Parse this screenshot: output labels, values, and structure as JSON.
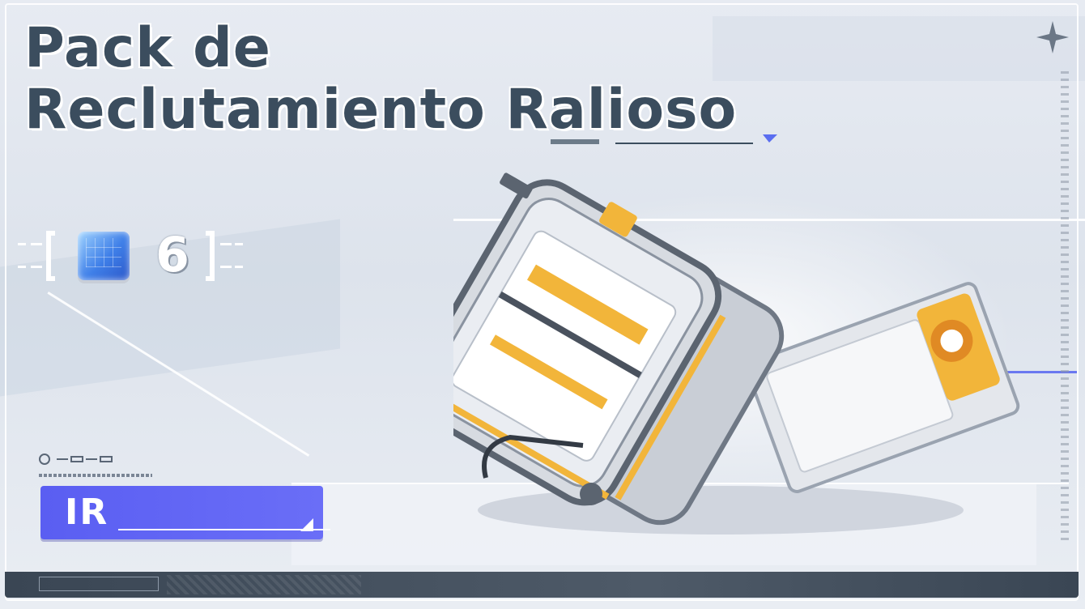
{
  "title": {
    "line1": "Pack de",
    "line2": "Reclutamiento Ralioso"
  },
  "reward": {
    "item_icon": "blue-cube-icon",
    "quantity": "6"
  },
  "go_button": {
    "label": "IR"
  },
  "icons": {
    "corner_star": "sparkle-star-icon",
    "case": "supply-case-illustration"
  },
  "colors": {
    "title": "#3b4d5e",
    "button": "#5a5ef2",
    "accent_yellow": "#f2b53a",
    "bottom_bar": "#3a4654"
  }
}
